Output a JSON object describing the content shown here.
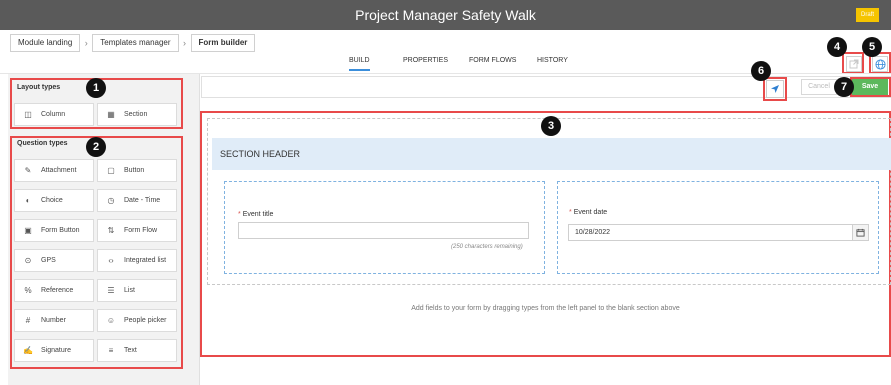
{
  "header": {
    "title": "Project Manager Safety Walk",
    "status_badge": "Draft"
  },
  "breadcrumbs": [
    {
      "label": "Module landing"
    },
    {
      "label": "Templates manager"
    },
    {
      "label": "Form builder"
    }
  ],
  "tabs": [
    {
      "label": "BUILD",
      "active": true
    },
    {
      "label": "PROPERTIES"
    },
    {
      "label": "FORM FLOWS"
    },
    {
      "label": "HISTORY"
    }
  ],
  "sidebar": {
    "layout_title": "Layout types",
    "layout_items": [
      {
        "label": "Column",
        "icon": "column-icon"
      },
      {
        "label": "Section",
        "icon": "section-icon"
      }
    ],
    "question_title": "Question types",
    "question_items": [
      {
        "label": "Attachment",
        "icon": "paperclip-icon"
      },
      {
        "label": "Button",
        "icon": "button-icon"
      },
      {
        "label": "Choice",
        "icon": "toggle-icon"
      },
      {
        "label": "Date - Time",
        "icon": "calendar-clock-icon"
      },
      {
        "label": "Form Button",
        "icon": "form-button-icon"
      },
      {
        "label": "Form Flow",
        "icon": "form-flow-icon"
      },
      {
        "label": "GPS",
        "icon": "location-pin-icon"
      },
      {
        "label": "Integrated list",
        "icon": "integrated-list-icon"
      },
      {
        "label": "Reference",
        "icon": "reference-link-icon"
      },
      {
        "label": "List",
        "icon": "list-icon"
      },
      {
        "label": "Number",
        "icon": "hash-icon"
      },
      {
        "label": "People picker",
        "icon": "person-icon"
      },
      {
        "label": "Signature",
        "icon": "signature-icon"
      },
      {
        "label": "Text",
        "icon": "text-lines-icon"
      }
    ]
  },
  "toolbar": {
    "cancel_label": "Cancel",
    "save_label": "Save"
  },
  "canvas": {
    "section_header": "SECTION HEADER",
    "event_title_label": "Event title",
    "event_title_value": "",
    "event_title_remaining": "(250 characters remaining)",
    "event_date_label": "Event date",
    "event_date_value": "10/28/2022",
    "empty_hint": "Add fields to your form by dragging types from the left panel to the blank section above"
  },
  "badges": [
    "1",
    "2",
    "3",
    "4",
    "5",
    "6",
    "7"
  ],
  "colors": {
    "titlebar": "#5a5a5a",
    "draft_badge": "#f5c400",
    "highlight": "#e84a4a",
    "save": "#5cb85c",
    "accent": "#3b8edb"
  }
}
